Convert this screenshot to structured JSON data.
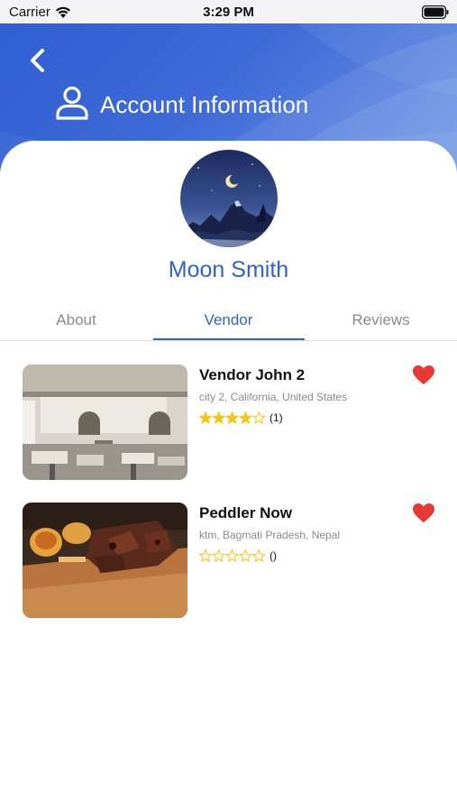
{
  "status_bar": {
    "carrier": "Carrier",
    "time": "3:29 PM"
  },
  "header": {
    "title": "Account Information"
  },
  "profile": {
    "name": "Moon Smith"
  },
  "tabs": [
    {
      "label": "About",
      "active": false
    },
    {
      "label": "Vendor",
      "active": true
    },
    {
      "label": "Reviews",
      "active": false
    }
  ],
  "vendors": [
    {
      "name": "Vendor John 2",
      "location": "city 2, California, United States",
      "rating": 4,
      "max_rating": 5,
      "count_label": "(1)",
      "favorited": true,
      "image": "restaurant-interior"
    },
    {
      "name": "Peddler Now",
      "location": "ktm, Bagmati Pradesh, Nepal",
      "rating": 0,
      "max_rating": 5,
      "count_label": "()",
      "favorited": true,
      "image": "grilled-food-platter"
    }
  ],
  "colors": {
    "accent": "#2f63c6",
    "heart": "#e53935",
    "star": "#f5c518",
    "header_gradient_start": "#2f5fd0",
    "header_gradient_end": "#6a92e2"
  },
  "icons": {
    "back": "chevron-left-icon",
    "user": "user-icon",
    "heart": "heart-icon",
    "star": "star-icon",
    "wifi": "wifi-icon",
    "battery": "battery-icon"
  }
}
